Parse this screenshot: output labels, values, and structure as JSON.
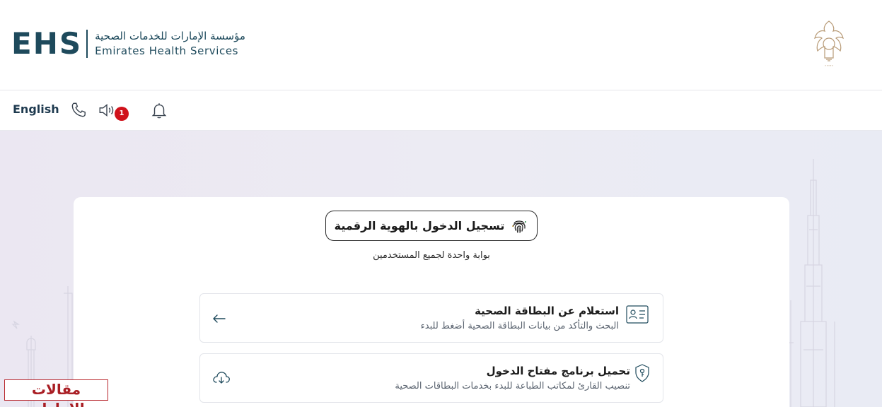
{
  "header": {
    "logo_letters": "EHS",
    "org_name_ar": "مؤسسة الإمارات للخدمات الصحية",
    "org_name_en": "Emirates Health Services",
    "emblem_icon": "uae-emblem-icon"
  },
  "toolbar": {
    "language_label": "English",
    "notification_count": "1",
    "icons": [
      "phone-icon",
      "speaker-icon",
      "bell-icon"
    ]
  },
  "login": {
    "uaepass_label": "تسجيل الدخول بالهوية الرقمية",
    "subtitle": "بوابة واحدة لجميع المستخدمين"
  },
  "services": [
    {
      "title": "استعلام عن البطاقة الصحية",
      "description": "البحث والتأكد من بيانات البطاقة الصحية أضغط للبدء",
      "icon": "id-card-icon",
      "action_icon": "arrow-left-icon"
    },
    {
      "title": "تحميل برنامج مفتاح الدخول",
      "description": "تنصيب القارئ لمكاتب الطباعة للبدء بخدمات البطاقات الصحية",
      "icon": "shield-key-icon",
      "action_icon": "cloud-download-icon"
    }
  ],
  "watermark": "مقالات الإمارات",
  "colors": {
    "brand": "#1e4a5c",
    "badge": "#d0121b",
    "background_tint": "#ecebf3",
    "watermark": "#a91e24"
  }
}
